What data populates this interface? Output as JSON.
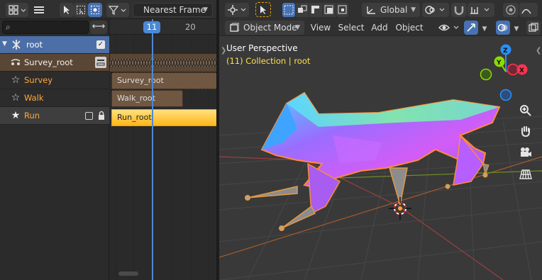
{
  "nla_editor": {
    "header": {
      "editor_type_icon": "nla-editor-icon",
      "menu_icon": "hamburger-icon",
      "select_tools_icons": [
        "cursor-select-icon",
        "box-select-icon",
        "tweak-select-icon"
      ],
      "filter_icon": "funnel-icon",
      "snap_mode_value": "Nearest Frame"
    },
    "sidebar": {
      "search_placeholder": "",
      "channels": [
        {
          "label": "root",
          "icon": "armature-icon",
          "type": "object",
          "checked": true
        },
        {
          "label": "Survey_root",
          "icon": "action-icon",
          "type": "action"
        },
        {
          "label": "Survey",
          "icon": "star-outline-icon",
          "type": "track"
        },
        {
          "label": "Walk",
          "icon": "star-outline-icon",
          "type": "track"
        },
        {
          "label": "Run",
          "icon": "star-filled-icon",
          "type": "track-active"
        }
      ]
    },
    "timeline": {
      "current_frame": "11",
      "ruler_label": "20",
      "strips": [
        {
          "label": "Survey_root",
          "track": "Survey"
        },
        {
          "label": "Walk_root",
          "track": "Walk"
        },
        {
          "label": "Run_root",
          "track": "Run"
        }
      ]
    }
  },
  "viewport": {
    "header": {
      "editor_type_icon": "3d-viewport-icon",
      "select_tool_icon": "cursor-arrow-icon",
      "select_mode_icons": [
        "set-new-icon",
        "extend-icon",
        "subtract-icon",
        "invert-icon",
        "intersect-icon"
      ],
      "transform_orientation": "Global",
      "pivot_icon": "pivot-icon",
      "snap_icon": "magnet-icon",
      "proportional_icon": "proportional-edit-icon",
      "mode": "Object Mode",
      "menus": [
        "View",
        "Select",
        "Add",
        "Object"
      ]
    },
    "overlay_info": {
      "view_name": "User Perspective",
      "collection_line": "(11) Collection | root"
    },
    "gizmo": {
      "x_label": "X",
      "y_label": "Y",
      "z_label": "Z"
    },
    "nav_icons": [
      "zoom-icon",
      "hand-pan-icon",
      "camera-icon",
      "grid-perspective-icon"
    ],
    "colors": {
      "x_axis": "#ff3352",
      "y_axis": "#8bdc00",
      "z_axis": "#2890ff",
      "active": "#4772b3",
      "selection": "#ffa030"
    }
  }
}
